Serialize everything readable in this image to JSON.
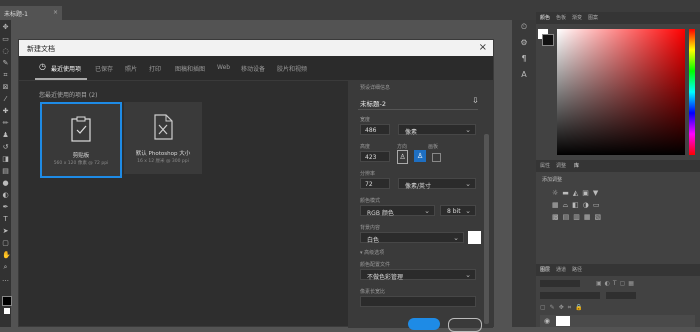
{
  "app": {
    "doc_tab": "未标题-1",
    "doc_tab_close": "×"
  },
  "right_panel": {
    "top_tabs": [
      "颜色",
      "色板",
      "渐变",
      "图案"
    ],
    "mid_tabs": [
      "属性",
      "调整",
      "库"
    ],
    "mid_heading": "添加调整",
    "bottom_tabs": [
      "图层",
      "通道",
      "路径"
    ]
  },
  "dialog": {
    "title": "新建文档",
    "close": "×",
    "tabs": [
      "最近使用项",
      "已保存",
      "照片",
      "打印",
      "图稿和插图",
      "Web",
      "移动设备",
      "胶片和视频"
    ],
    "active_tab": 0,
    "recent_label": "您最近使用的项目 (2)",
    "cards": [
      {
        "name": "剪贴板",
        "sub": "560 x 120 像素 @ 72 ppi"
      },
      {
        "name": "默认 Photoshop 大小",
        "sub": "16 x 12 厘米 @ 300 ppi"
      }
    ],
    "details": {
      "heading": "预设详细信息",
      "name": "未标题-2",
      "width_label": "宽度",
      "width": "486",
      "width_unit": "像素",
      "height_label": "高度",
      "height": "423",
      "orientation_label": "方向",
      "artboard_label": "画板",
      "resolution_label": "分辨率",
      "resolution": "72",
      "resolution_unit": "像素/英寸",
      "color_mode_label": "颜色模式",
      "color_mode": "RGB 颜色",
      "bit_depth": "8 bit",
      "background_label": "背景内容",
      "background": "白色",
      "advanced_label": "高级选项",
      "color_profile_label": "颜色配置文件",
      "color_profile": "不做色彩管理",
      "pixel_ratio_label": "像素长宽比"
    }
  },
  "colors": {
    "accent": "#1e8be6",
    "dialog_bg": "#2e2e2e",
    "pane_bg": "#3a3a3a"
  }
}
